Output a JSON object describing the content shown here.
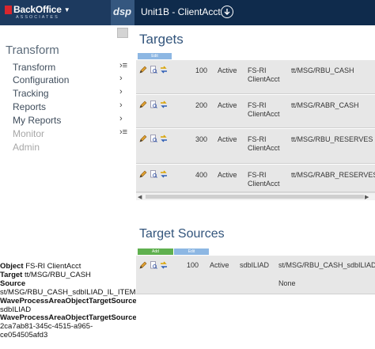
{
  "header": {
    "logo_text": "BackOffice",
    "logo_sub": "ASSOCIATES",
    "app_badge": "dsp",
    "context_title": "Unit1B - ClientAcct"
  },
  "nav": {
    "title": "Transform",
    "items": [
      {
        "label": "Transform",
        "enabled": true,
        "icon": "expand-arrow-icon"
      },
      {
        "label": "Configuration",
        "enabled": true,
        "icon": "chevron-right-icon"
      },
      {
        "label": "Tracking",
        "enabled": true,
        "icon": "chevron-right-icon"
      },
      {
        "label": "Reports",
        "enabled": true,
        "icon": "chevron-right-icon"
      },
      {
        "label": "My Reports",
        "enabled": true,
        "icon": "chevron-right-icon"
      },
      {
        "label": "Monitor",
        "enabled": false,
        "icon": "expand-arrow-icon"
      },
      {
        "label": "Admin",
        "enabled": false,
        "icon": ""
      }
    ]
  },
  "info_panel": {
    "object_label": "Object",
    "object_value": "FS-RI ClientAcct",
    "target_label": "Target",
    "target_value": "tt/MSG/RBU_CASH",
    "source_label": "Source",
    "source_value": "st/MSG/RBU_CASH_sdbILIAD_IL_ITEM",
    "wpaots_label_1": "WaveProcessAreaObjectTargetSourceI",
    "wpaots_value_1": "sdbILIAD",
    "wpaots_label_2": "WaveProcessAreaObjectTargetSourceT",
    "wpaots_value_2a": "2ca7ab81-345c-4515-a965-",
    "wpaots_value_2b": "ce054505afd3"
  },
  "targets": {
    "title": "Targets",
    "edit_label": "Edit",
    "rows": [
      {
        "priority": "100",
        "status": "Active",
        "object_line1": "FS-RI",
        "object_line2": "ClientAcct",
        "target": "tt/MSG/RBU_CASH"
      },
      {
        "priority": "200",
        "status": "Active",
        "object_line1": "FS-RI",
        "object_line2": "ClientAcct",
        "target": "tt/MSG/RABR_CASH"
      },
      {
        "priority": "300",
        "status": "Active",
        "object_line1": "FS-RI",
        "object_line2": "ClientAcct",
        "target": "tt/MSG/RBU_RESERVES"
      },
      {
        "priority": "400",
        "status": "Active",
        "object_line1": "FS-RI",
        "object_line2": "ClientAcct",
        "target": "tt/MSG/RABR_RESERVES"
      }
    ]
  },
  "target_sources": {
    "title": "Target Sources",
    "add_label": "Add",
    "edit_label": "Edit",
    "rows": [
      {
        "priority": "100",
        "status": "Active",
        "source_db": "sdbILIAD",
        "source": "st/MSG/RBU_CASH_sdbILIAD_IL",
        "extra": "None"
      }
    ]
  },
  "colors": {
    "header_bg": "#1d3a5f",
    "accent_title": "#33557c",
    "row_bg": "#e7e7e7",
    "add_green": "#5fb04f",
    "edit_blue": "#8db7e3"
  }
}
